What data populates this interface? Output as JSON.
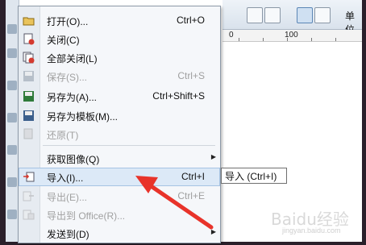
{
  "toolbar": {
    "unit_label": "单位"
  },
  "ruler": {
    "ticks": [
      "0",
      "100"
    ]
  },
  "menu": {
    "items": [
      {
        "label": "打开(O)...",
        "shortcut": "Ctrl+O",
        "icon": "open-folder-icon",
        "disabled": false
      },
      {
        "label": "关闭(C)",
        "shortcut": "",
        "icon": "close-doc-icon",
        "disabled": false
      },
      {
        "label": "全部关闭(L)",
        "shortcut": "",
        "icon": "close-all-icon",
        "disabled": false
      },
      {
        "label": "保存(S)...",
        "shortcut": "Ctrl+S",
        "icon": "save-icon",
        "disabled": true
      },
      {
        "label": "另存为(A)...",
        "shortcut": "Ctrl+Shift+S",
        "icon": "save-as-icon",
        "disabled": false
      },
      {
        "label": "另存为模板(M)...",
        "shortcut": "",
        "icon": "save-template-icon",
        "disabled": false
      },
      {
        "label": "还原(T)",
        "shortcut": "",
        "icon": "revert-icon",
        "disabled": true
      },
      {
        "label": "获取图像(Q)",
        "shortcut": "",
        "icon": "",
        "disabled": false,
        "submenu": true
      },
      {
        "label": "导入(I)...",
        "shortcut": "Ctrl+I",
        "icon": "import-icon",
        "disabled": false,
        "hover": true
      },
      {
        "label": "导出(E)...",
        "shortcut": "Ctrl+E",
        "icon": "export-icon",
        "disabled": true
      },
      {
        "label": "导出到 Office(R)...",
        "shortcut": "",
        "icon": "export-office-icon",
        "disabled": true
      },
      {
        "label": "发送到(D)",
        "shortcut": "",
        "icon": "",
        "disabled": false,
        "submenu": true
      }
    ]
  },
  "tooltip": {
    "text": "导入 (Ctrl+I)"
  },
  "watermark": {
    "text": "Baidu经验",
    "sub": "jingyan.baidu.com"
  },
  "colors": {
    "arrow": "#e8332a",
    "hover": "#dce9f7"
  }
}
